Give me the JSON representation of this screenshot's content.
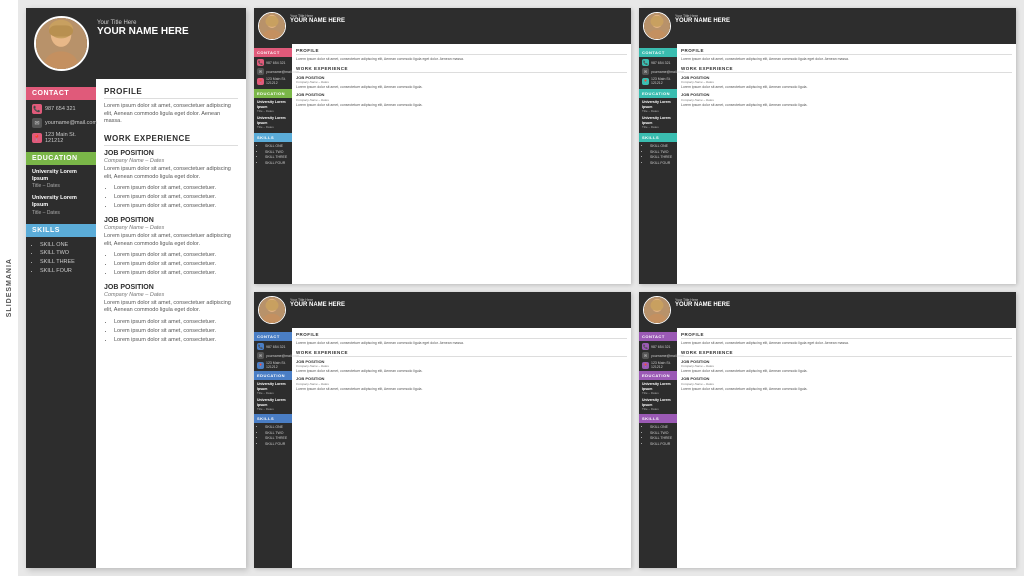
{
  "brand": "SLIDESMANIA",
  "resume": {
    "title_here": "Your Title Here",
    "your_name": "YOUR NAME HERE",
    "profile_heading": "PROFILE",
    "profile_text": "Lorem ipsum dolor sit amet, consectetuer adipiscing elit, Aenean commodo ligula eget dolor. Aenean massa.",
    "contact_heading": "CONTACT",
    "phone": "987 654 321",
    "email": "yourname@mail.com",
    "address": "123 Main St. 121212",
    "education_heading": "EDUCATION",
    "university1": "University Lorem Ipsum",
    "title_dates1": "Title – Dates",
    "university2": "University Lorem Ipsum",
    "title_dates2": "Title – Dates",
    "skills_heading": "SKILLS",
    "skills": [
      "SKILL ONE",
      "SKILL TWO",
      "SKILL THREE",
      "SKILL FOUR"
    ],
    "work_experience_heading": "WORK EXPERIENCE",
    "jobs": [
      {
        "position": "JOB POSITION",
        "company": "Company Name – Dates",
        "desc": "Lorem ipsum dolor sit amet, consectetuer adipiscing elit, Aenean commodo ligula eget dolor.",
        "bullets": [
          "Lorem ipsum dolor sit amet, consectetuer.",
          "Lorem ipsum dolor sit amet, consectetuer.",
          "Lorem ipsum dolor sit amet, consectetuer."
        ]
      },
      {
        "position": "JOB POSITION",
        "company": "Company Name – Dates",
        "desc": "Lorem ipsum dolor sit amet, consectetuer adipiscing elit, Aenean commodo ligula eget dolor.",
        "bullets": [
          "Lorem ipsum dolor sit amet, consectetuer.",
          "Lorem ipsum dolor sit amet, consectetuer.",
          "Lorem ipsum dolor sit amet, consectetuer."
        ]
      },
      {
        "position": "JOB POSITION",
        "company": "Company Name – Dates",
        "desc": "Lorem ipsum dolor sit amet, consectetuer adipiscing elit, Aenean commodo ligula eget dolor.",
        "bullets": [
          "Lorem ipsum dolor sit amet, consectetuer.",
          "Lorem ipsum dolor sit amet, consectetuer.",
          "Lorem ipsum dolor sit amet, consectetuer."
        ]
      }
    ]
  },
  "variants": [
    {
      "accent": "pink",
      "contact_color": "#e05a7a",
      "edu_color": "#7ab648",
      "skills_color": "#5bacd8"
    },
    {
      "accent": "teal",
      "contact_color": "#3abdb0",
      "edu_color": "#3abdb0",
      "skills_color": "#3abdb0"
    },
    {
      "accent": "blue",
      "contact_color": "#4a7ec5",
      "edu_color": "#4a7ec5",
      "skills_color": "#4a7ec5"
    },
    {
      "accent": "purple",
      "contact_color": "#9b5ab5",
      "edu_color": "#9b5ab5",
      "skills_color": "#9b5ab5"
    }
  ]
}
